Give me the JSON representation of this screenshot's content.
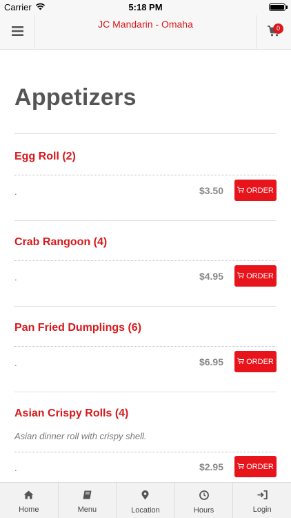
{
  "status_bar": {
    "carrier": "Carrier",
    "time": "5:18 PM",
    "icons": [
      "wifi-icon",
      "battery-icon"
    ]
  },
  "header": {
    "title": "JC Mandarin - Omaha",
    "cart_count": "0",
    "icons": [
      "hamburger-menu-icon",
      "shopping-cart-icon"
    ]
  },
  "category": {
    "title": "Appetizers"
  },
  "items": [
    {
      "name": "Egg Roll (2)",
      "description": "",
      "dot": ".",
      "price": "$3.50",
      "order_label": "ORDER"
    },
    {
      "name": "Crab Rangoon (4)",
      "description": "",
      "dot": ".",
      "price": "$4.95",
      "order_label": "ORDER"
    },
    {
      "name": "Pan Fried Dumplings (6)",
      "description": "",
      "dot": ".",
      "price": "$6.95",
      "order_label": "ORDER"
    },
    {
      "name": "Asian Crispy Rolls (4)",
      "description": "Asian dinner roll with crispy shell.",
      "dot": ".",
      "price": "$2.95",
      "order_label": "ORDER"
    }
  ],
  "tabs": [
    {
      "label": "Home",
      "icon": "home-icon"
    },
    {
      "label": "Menu",
      "icon": "book-icon"
    },
    {
      "label": "Location",
      "icon": "map-pin-icon"
    },
    {
      "label": "Hours",
      "icon": "clock-icon"
    },
    {
      "label": "Login",
      "icon": "login-icon"
    }
  ],
  "colors": {
    "accent": "#e8141c",
    "title_red": "#d7191c",
    "text_gray": "#555555",
    "price_gray": "#888888"
  }
}
